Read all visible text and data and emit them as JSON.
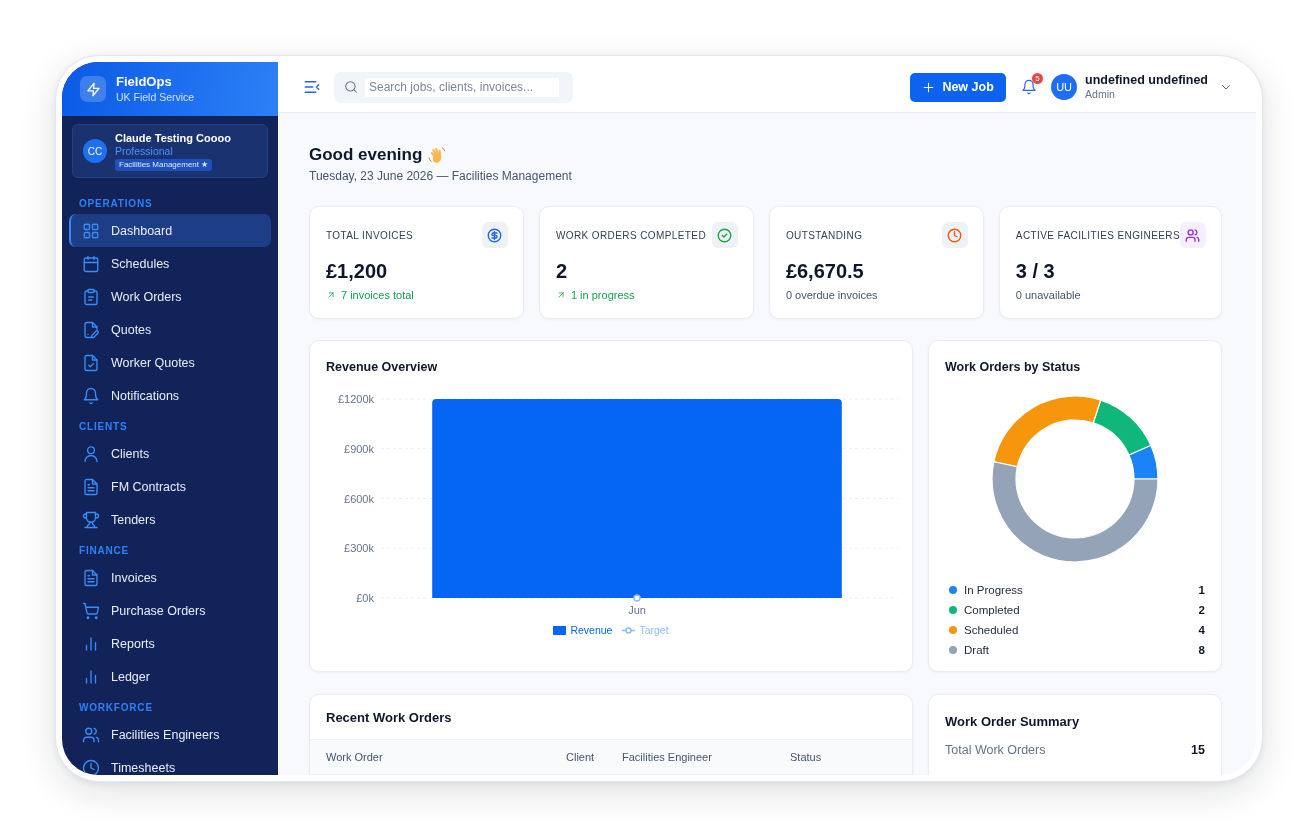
{
  "sidebar": {
    "brand": {
      "name": "FieldOps",
      "subtitle": "UK Field Service"
    },
    "organization": {
      "initials": "CC",
      "name": "Claude Testing Coooo",
      "plan": "Professional",
      "badge": "Facilities Management ★"
    },
    "sections": [
      {
        "title": "OPERATIONS",
        "items": [
          {
            "label": "Dashboard",
            "selected": true
          },
          {
            "label": "Schedules",
            "selected": false
          },
          {
            "label": "Work Orders",
            "selected": false
          },
          {
            "label": "Quotes",
            "selected": false
          },
          {
            "label": "Worker Quotes",
            "selected": false
          },
          {
            "label": "Notifications",
            "selected": false
          }
        ]
      },
      {
        "title": "CLIENTS",
        "items": [
          {
            "label": "Clients",
            "selected": false
          },
          {
            "label": "FM Contracts",
            "selected": false
          },
          {
            "label": "Tenders",
            "selected": false
          }
        ]
      },
      {
        "title": "FINANCE",
        "items": [
          {
            "label": "Invoices",
            "selected": false
          },
          {
            "label": "Purchase Orders",
            "selected": false
          },
          {
            "label": "Reports",
            "selected": false
          },
          {
            "label": "Ledger",
            "selected": false
          }
        ]
      },
      {
        "title": "WORKFORCE",
        "items": [
          {
            "label": "Facilities Engineers",
            "selected": false
          },
          {
            "label": "Timesheets",
            "selected": false
          }
        ]
      }
    ]
  },
  "topbar": {
    "search": {
      "placeholder": "Search jobs, clients, invoices..."
    },
    "new_job_button": "New Job",
    "notification_count": "5",
    "user": {
      "initials": "UU",
      "name": "undefined undefined",
      "role": "Admin"
    }
  },
  "greeting": {
    "title": "Good evening",
    "date_line": "Tuesday, 23 June 2026 — Facilities Management"
  },
  "stats": [
    {
      "label": "TOTAL INVOICES",
      "value": "£1,200",
      "note": "7 invoices total",
      "positive": true
    },
    {
      "label": "WORK ORDERS COMPLETED",
      "value": "2",
      "note": "1 in progress",
      "positive": true
    },
    {
      "label": "OUTSTANDING",
      "value": "£6,670.5",
      "note": "0 overdue invoices",
      "positive": false
    },
    {
      "label": "ACTIVE FACILITIES ENGINEERS",
      "value": "3 / 3",
      "note": "0 unavailable",
      "positive": false
    }
  ],
  "revenue_overview": {
    "title": "Revenue Overview",
    "chart_data": {
      "type": "bar",
      "categories": [
        "Jun"
      ],
      "series": [
        {
          "name": "Revenue",
          "color": "#0566f3",
          "values": [
            1200
          ]
        },
        {
          "name": "Target",
          "color": "#8fbdf9",
          "values": [
            0
          ]
        }
      ],
      "ylim": [
        0,
        1200
      ],
      "yticks": [
        {
          "value": 0,
          "label": "£0k"
        },
        {
          "value": 300,
          "label": "£300k"
        },
        {
          "value": 600,
          "label": "£600k"
        },
        {
          "value": 900,
          "label": "£900k"
        },
        {
          "value": 1200,
          "label": "£1200k"
        }
      ],
      "grid": true
    },
    "series_marks": [
      {
        "kind": "bar"
      },
      {
        "kind": "line"
      }
    ]
  },
  "work_orders_by_status": {
    "title": "Work Orders by Status",
    "chart_data": {
      "type": "donut",
      "categories": [
        "In Progress",
        "Completed",
        "Scheduled",
        "Draft"
      ],
      "values": [
        6.67,
        13.33,
        26.67,
        53.33
      ],
      "colors": [
        "#1a84f6",
        "#10b77a",
        "#f7960d",
        "#94a3b8"
      ]
    },
    "counts": [
      "1",
      "2",
      "4",
      "8"
    ]
  },
  "recent_work_orders": {
    "title": "Recent Work Orders",
    "columns": [
      "Work Order",
      "Client",
      "Facilities Engineer",
      "Status"
    ]
  },
  "work_order_summary": {
    "title": "Work Order Summary",
    "rows": [
      {
        "label": "Total Work Orders",
        "value": "15"
      }
    ]
  }
}
